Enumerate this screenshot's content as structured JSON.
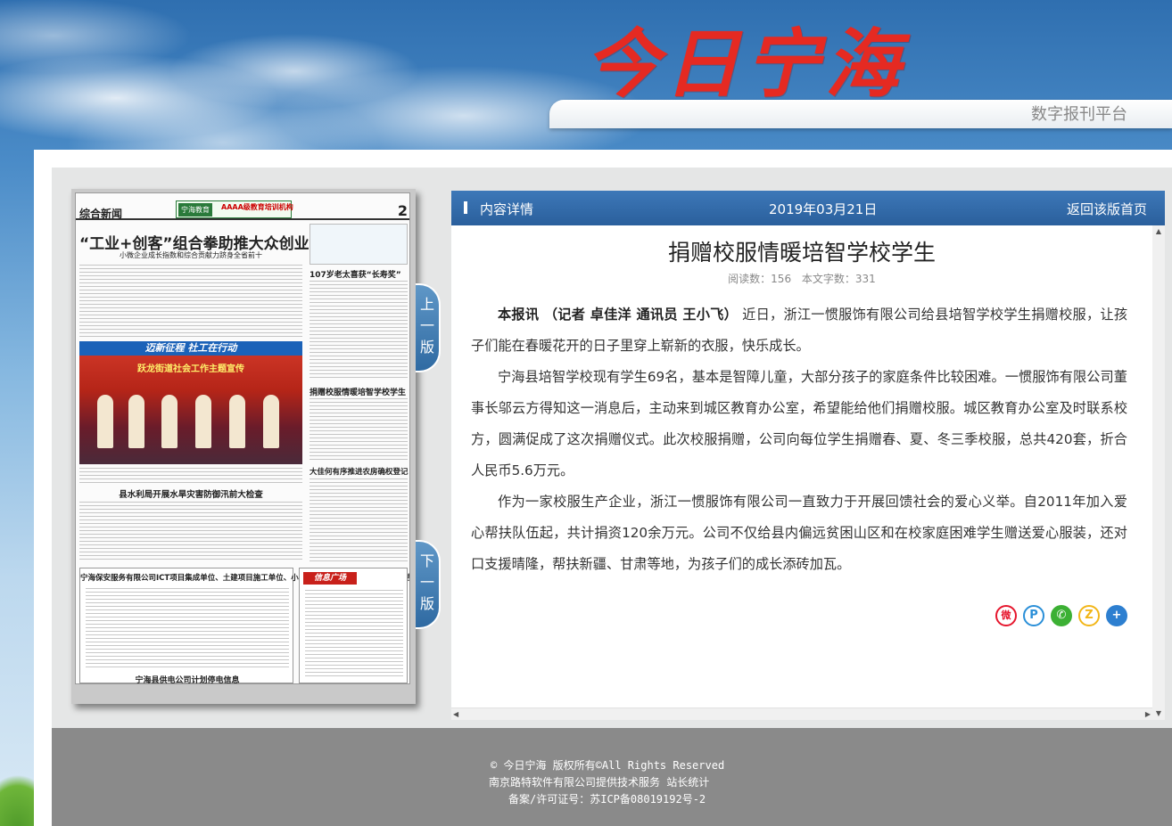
{
  "header": {
    "logo_text": "今日宁海",
    "subtitle": "数字报刊平台"
  },
  "newspaper": {
    "section": "综合新闻",
    "page_number": "2",
    "ad_logo": "宁海教育",
    "ad_text": "AAAA级教育培训机构",
    "headline": "“工业+创客”组合拳助推大众创业",
    "subheadline": "小微企业成长指数和综合贡献力跻身全省前十",
    "photo_banner": "迈新征程 社工在行动",
    "photo_caption": "跃龙街道社会工作主题宣传",
    "side_headline_1": "107岁老太喜获“长寿奖”",
    "side_headline_2": "捐赠校服情暖培智学校学生",
    "side_headline_3": "大佳何有序推进农房确权登记",
    "headline_2": "县水利局开展水旱灾害防御汛前大检查",
    "ad_block_title": "宁海保安服务有限公司ICT项目集成单位、土建项目施工单位、小型项目施工单位入围项目采购公告",
    "info_band": "信息广场",
    "bottom_title": "宁海县供电公司计划停电信息"
  },
  "nav": {
    "prev_page": "上一版",
    "next_page": "下一版"
  },
  "content_bar": {
    "title": "内容详情",
    "date": "2019年03月21日",
    "back": "返回该版首页"
  },
  "article": {
    "title": "捐赠校服情暖培智学校学生",
    "read_count": "阅读数：156",
    "word_count": "本文字数：331",
    "lead": "本报讯 （记者 卓佳洋 通讯员 王小飞）",
    "paragraph_1": "近日，浙江一惯服饰有限公司给县培智学校学生捐赠校服，让孩子们能在春暖花开的日子里穿上崭新的衣服，快乐成长。",
    "paragraph_2": "宁海县培智学校现有学生69名，基本是智障儿童，大部分孩子的家庭条件比较困难。一惯服饰有限公司董事长邬云方得知这一消息后，主动来到城区教育办公室，希望能给他们捐赠校服。城区教育办公室及时联系校方，圆满促成了这次捐赠仪式。此次校服捐赠，公司向每位学生捐赠春、夏、冬三季校服，总共420套，折合人民币5.6万元。",
    "paragraph_3": "作为一家校服生产企业，浙江一惯服饰有限公司一直致力于开展回馈社会的爱心义举。自2011年加入爱心帮扶队伍起，共计捐资120余万元。公司不仅给县内偏远贫困山区和在校家庭困难学生赠送爱心服装，还对口支援晴隆，帮扶新疆、甘肃等地，为孩子们的成长添砖加瓦。"
  },
  "share": {
    "weibo": "微",
    "qzone": "P",
    "wechat": "✆",
    "qq": "Z",
    "more": "+"
  },
  "footer": {
    "copyright": "© 今日宁海 版权所有©All Rights Reserved",
    "tech": "南京路特软件有限公司提供技术服务  站长统计",
    "icp": "备案/许可证号：苏ICP备08019192号-2"
  },
  "colors": {
    "logo_red": "#e52a22",
    "bar_blue": "#2f6aa2",
    "footer_gray": "#8a8a8a"
  }
}
